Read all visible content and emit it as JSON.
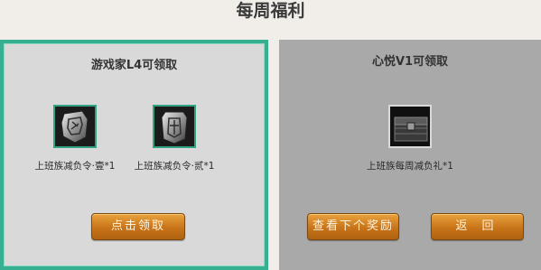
{
  "title": "每周福利",
  "left_panel": {
    "title": "游戏家L4可领取",
    "items": [
      {
        "label": "上班族减负令·壹*1",
        "icon": "silver-token-icon"
      },
      {
        "label": "上班族减负令·贰*1",
        "icon": "silver-shield-token-icon"
      }
    ],
    "claim_button": "点击领取"
  },
  "right_panel": {
    "title": "心悦V1可领取",
    "items": [
      {
        "label": "上班族每周减负礼*1",
        "icon": "gift-chest-icon"
      }
    ],
    "next_button": "查看下个奖励",
    "back_button": "返 回"
  },
  "colors": {
    "accent_border": "#35b090",
    "button": "#d07d20"
  }
}
